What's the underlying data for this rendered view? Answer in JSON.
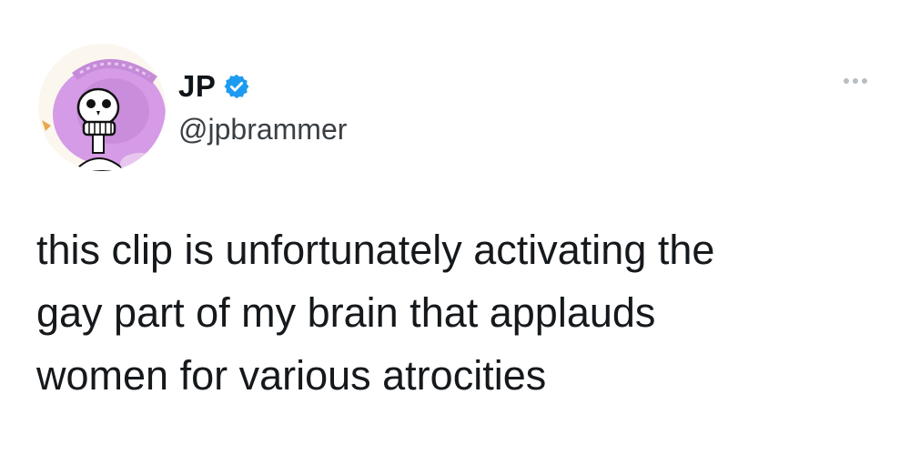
{
  "tweet": {
    "author": {
      "display_name": "JP",
      "handle": "@jpbrammer",
      "verified": true,
      "avatar_icon": "skeleton-sombrero-avatar"
    },
    "more_icon": "more-options-icon",
    "text_lines": [
      "this clip is unfortunately activating the",
      "gay part of my brain that applauds",
      "women for various atrocities"
    ]
  },
  "colors": {
    "verified_badge": "#1d9bf0",
    "text": "#0f1419",
    "handle": "#3a3f44",
    "sombrero": "#d59be6"
  }
}
